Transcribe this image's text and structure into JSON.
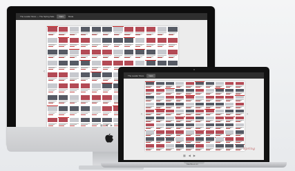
{
  "imac": {
    "toolbar": {
      "title": "The Leader Store — The Spring Sale",
      "tab_label": "Cars",
      "button": "Mode"
    },
    "bottom_controls": [
      "▦",
      "◀",
      "▶"
    ]
  },
  "macbook": {
    "toolbar": {
      "title": "The Leader Store",
      "tab_label": "Cars"
    },
    "bottom_controls": [
      "▦",
      "◀",
      "▶"
    ],
    "label": "MacBook Air",
    "signature": "Spring"
  },
  "colors": {
    "dark": "#121212",
    "accent": "#c62828",
    "paper": "#ffffff"
  }
}
